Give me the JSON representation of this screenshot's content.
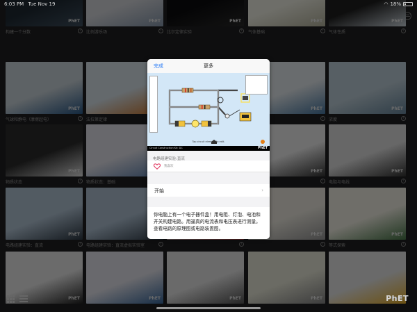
{
  "status": {
    "time": "6:03 PM",
    "date": "Tue Nov 19",
    "battery": "18%",
    "battery_level": 0.18
  },
  "topbar": {
    "back_label": "搜索"
  },
  "tiles": [
    {
      "label": "构建一个分数"
    },
    {
      "label": "比例游乐场"
    },
    {
      "label": "比尔定律实验"
    },
    {
      "label": "气体基础"
    },
    {
      "label": ""
    },
    {
      "label": "气体性质"
    },
    {
      "label": "气球和静电（摩擦起电）"
    },
    {
      "label": "法拉第定律"
    },
    {
      "label": ""
    },
    {
      "label": ""
    },
    {
      "label": ""
    },
    {
      "label": "浓度"
    },
    {
      "label": "物质状态"
    },
    {
      "label": "物质状态：基础"
    },
    {
      "label": ""
    },
    {
      "label": ""
    },
    {
      "label": ""
    },
    {
      "label": "电阻与电线"
    },
    {
      "label": "电路组建实验：直流"
    },
    {
      "label": "电路组建实验：直流虚拟实验室"
    },
    {
      "label": ""
    },
    {
      "label": ""
    },
    {
      "label": ""
    },
    {
      "label": "等式探索"
    }
  ],
  "tile_mini_logo": "PhET",
  "popover": {
    "done_label": "完成",
    "title": "更多",
    "thumb_title": "Circuit Construction Kit: DC",
    "thumb_logo": "PhET",
    "thumb_hint": "Tap circuit element to edit.",
    "sim_name": "电路组建实验:直流",
    "favorite_label": "我喜欢",
    "start_label": "开始",
    "description": "你电脑上有一个电子器件盒！用电阻、灯泡、电池和开关构建电路。用逼真的电流表和电压表进行测量。查看电路的原理图或电路装置图。"
  },
  "logo": "PhET",
  "colors": {
    "accent": "#2a7cf6",
    "background": "#202022"
  }
}
